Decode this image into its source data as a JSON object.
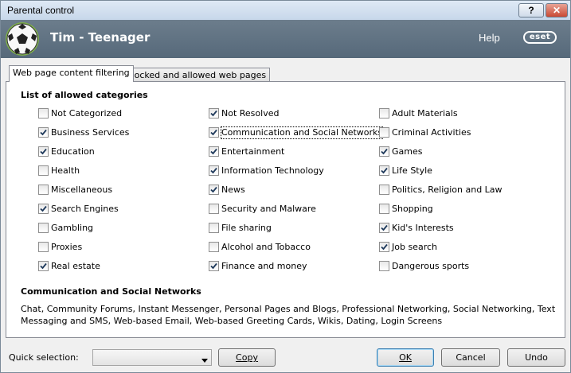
{
  "window": {
    "title": "Parental control",
    "help_button": "?",
    "close_button": "✕"
  },
  "header": {
    "user_name": "Tim - Teenager",
    "help_link": "Help",
    "logo_text": "eset"
  },
  "tabs": [
    {
      "label": "Web page content filtering",
      "active": true
    },
    {
      "label": "Blocked and allowed web pages",
      "active": false
    }
  ],
  "list_heading": "List of allowed categories",
  "categories": [
    {
      "label": "Not Categorized",
      "checked": false
    },
    {
      "label": "Not Resolved",
      "checked": true
    },
    {
      "label": "Adult Materials",
      "checked": false
    },
    {
      "label": "Business Services",
      "checked": true
    },
    {
      "label": "Communication and Social Networks",
      "checked": true
    },
    {
      "label": "Criminal Activities",
      "checked": false
    },
    {
      "label": "Education",
      "checked": true
    },
    {
      "label": "Entertainment",
      "checked": true
    },
    {
      "label": "Games",
      "checked": true
    },
    {
      "label": "Health",
      "checked": false
    },
    {
      "label": "Information Technology",
      "checked": true
    },
    {
      "label": "Life Style",
      "checked": true
    },
    {
      "label": "Miscellaneous",
      "checked": false
    },
    {
      "label": "News",
      "checked": true
    },
    {
      "label": "Politics, Religion and Law",
      "checked": false
    },
    {
      "label": "Search Engines",
      "checked": true
    },
    {
      "label": "Security and Malware",
      "checked": false
    },
    {
      "label": "Shopping",
      "checked": false
    },
    {
      "label": "Gambling",
      "checked": false
    },
    {
      "label": "File sharing",
      "checked": false
    },
    {
      "label": "Kid's Interests",
      "checked": true
    },
    {
      "label": "Proxies",
      "checked": false
    },
    {
      "label": "Alcohol and Tobacco",
      "checked": false
    },
    {
      "label": "Job search",
      "checked": true
    },
    {
      "label": "Real estate",
      "checked": true
    },
    {
      "label": "Finance and money",
      "checked": true
    },
    {
      "label": "Dangerous sports",
      "checked": false
    }
  ],
  "description": {
    "heading": "Communication and Social Networks",
    "text": "Chat, Community Forums, Instant Messenger, Personal Pages and Blogs, Professional Networking, Social Networking, Text Messaging and SMS, Web-based Email, Web-based Greeting Cards, Wikis, Dating, Login Screens"
  },
  "footer": {
    "quick_selection_label": "Quick selection:",
    "quick_selection_value": "",
    "copy_button": "Copy",
    "ok_button": "OK",
    "cancel_button": "Cancel",
    "undo_button": "Undo"
  },
  "colors": {
    "header_bg": "#5f7282",
    "accent": "#3c7fb1",
    "close_red": "#c94a34"
  }
}
